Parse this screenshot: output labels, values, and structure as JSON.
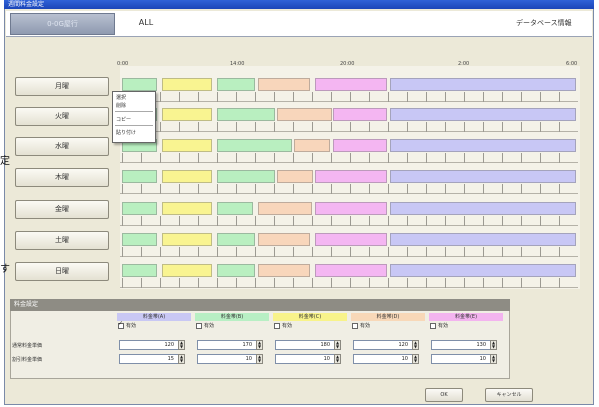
{
  "window": {
    "title": "週間料金設定"
  },
  "tabs": [
    {
      "label": "0-0G屋行"
    },
    {
      "label": "ALL"
    }
  ],
  "header_right": "データベース情報",
  "time_axis": [
    "0:00",
    "14:00",
    "20:00",
    "2:00",
    "6:00"
  ],
  "days": [
    {
      "label": "月曜"
    },
    {
      "label": "火曜"
    },
    {
      "label": "水曜"
    },
    {
      "label": "木曜"
    },
    {
      "label": "金曜"
    },
    {
      "label": "土曜"
    },
    {
      "label": "日曜"
    }
  ],
  "context_menu": {
    "items": [
      "選択",
      "削除",
      "コピー",
      "貼り付け"
    ]
  },
  "side_chars": [
    "定",
    "す"
  ],
  "settings": {
    "title": "料金設定",
    "columns": [
      {
        "label": "料金帯(A)",
        "checkbox": "有効",
        "checked": true,
        "color": "#c9c8f4"
      },
      {
        "label": "料金帯(B)",
        "checkbox": "有効",
        "checked": false,
        "color": "#b8efc4"
      },
      {
        "label": "料金帯(C)",
        "checkbox": "有効",
        "checked": false,
        "color": "#f8f38a"
      },
      {
        "label": "料金帯(D)",
        "checkbox": "有効",
        "checked": false,
        "color": "#f8d8b8"
      },
      {
        "label": "料金帯(E)",
        "checkbox": "有効",
        "checked": false,
        "color": "#f3b4ef"
      }
    ],
    "rows": [
      {
        "label": "通常料金単価",
        "values": [
          "120",
          "170",
          "180",
          "120",
          "130"
        ]
      },
      {
        "label": "割引料金単価",
        "values": [
          "15",
          "10",
          "10",
          "10",
          "10"
        ]
      }
    ]
  },
  "buttons": {
    "ok": "OK",
    "cancel": "キャンセル"
  },
  "colors": {
    "green": "#b9efc0",
    "yellow": "#f9f491",
    "peach": "#f8d6bb",
    "pink": "#f4b6f2",
    "lavender": "#c8c7f5"
  }
}
